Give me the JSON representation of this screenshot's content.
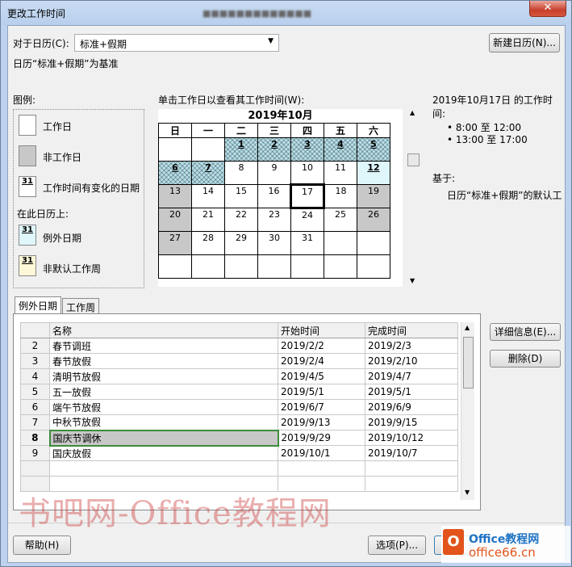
{
  "window": {
    "title": "更改工作时间",
    "subtitle": "■■■■■■■■■■■■■"
  },
  "calendar_for": {
    "label": "对于日历(C):",
    "value": "标准+假期"
  },
  "base_note": "日历“标准+假期”为基准",
  "new_calendar_button": "新建日历(N)...",
  "legend": {
    "title": "图例:",
    "items": [
      {
        "label": "工作日",
        "style": "working"
      },
      {
        "label": "非工作日",
        "style": "nonworking"
      },
      {
        "label": "工作时间有变化的日期",
        "style": "changed",
        "sample": "31"
      }
    ],
    "on_this_calendar": "在此日历上:",
    "calendar_items": [
      {
        "label": "例外日期",
        "style": "exception",
        "sample": "31"
      },
      {
        "label": "非默认工作周",
        "style": "nondefault",
        "sample": "31"
      }
    ]
  },
  "calendar": {
    "prompt": "单击工作日以查看其工作时间(W):",
    "month_title": "2019年10月",
    "weekdays": [
      "日",
      "一",
      "二",
      "三",
      "四",
      "五",
      "六"
    ],
    "weeks": [
      [
        {
          "d": "",
          "t": "blank"
        },
        {
          "d": "",
          "t": "blank"
        },
        {
          "d": "1",
          "t": "ex"
        },
        {
          "d": "2",
          "t": "ex"
        },
        {
          "d": "3",
          "t": "ex"
        },
        {
          "d": "4",
          "t": "ex"
        },
        {
          "d": "5",
          "t": "ex"
        }
      ],
      [
        {
          "d": "6",
          "t": "ex"
        },
        {
          "d": "7",
          "t": "ex"
        },
        {
          "d": "8",
          "t": "w"
        },
        {
          "d": "9",
          "t": "w"
        },
        {
          "d": "10",
          "t": "w"
        },
        {
          "d": "11",
          "t": "w"
        },
        {
          "d": "12",
          "t": "ch"
        }
      ],
      [
        {
          "d": "13",
          "t": "nw"
        },
        {
          "d": "14",
          "t": "w"
        },
        {
          "d": "15",
          "t": "w"
        },
        {
          "d": "16",
          "t": "w"
        },
        {
          "d": "17",
          "t": "today"
        },
        {
          "d": "18",
          "t": "w"
        },
        {
          "d": "19",
          "t": "nw"
        }
      ],
      [
        {
          "d": "20",
          "t": "nw"
        },
        {
          "d": "21",
          "t": "w"
        },
        {
          "d": "22",
          "t": "w"
        },
        {
          "d": "23",
          "t": "w"
        },
        {
          "d": "24",
          "t": "w"
        },
        {
          "d": "25",
          "t": "w"
        },
        {
          "d": "26",
          "t": "nw"
        }
      ],
      [
        {
          "d": "27",
          "t": "nw"
        },
        {
          "d": "28",
          "t": "w"
        },
        {
          "d": "29",
          "t": "w"
        },
        {
          "d": "30",
          "t": "w"
        },
        {
          "d": "31",
          "t": "w"
        },
        {
          "d": "",
          "t": "blank"
        },
        {
          "d": "",
          "t": "blank"
        }
      ],
      [
        {
          "d": "",
          "t": "blank"
        },
        {
          "d": "",
          "t": "blank"
        },
        {
          "d": "",
          "t": "blank"
        },
        {
          "d": "",
          "t": "blank"
        },
        {
          "d": "",
          "t": "blank"
        },
        {
          "d": "",
          "t": "blank"
        },
        {
          "d": "",
          "t": "blank"
        }
      ]
    ]
  },
  "work_times": {
    "heading": "2019年10月17日 的工作时间:",
    "items": [
      "8:00 至 12:00",
      "13:00 至 17:00"
    ],
    "based_on_label": "基于:",
    "based_on_text": "日历“标准+假期”的默认工"
  },
  "tabs": [
    "例外日期",
    "工作周"
  ],
  "exceptions_table": {
    "headers": [
      "名称",
      "开始时间",
      "完成时间"
    ],
    "rows": [
      {
        "n": "2",
        "name": "春节调班",
        "start": "2019/2/2",
        "end": "2019/2/3"
      },
      {
        "n": "3",
        "name": "春节放假",
        "start": "2019/2/4",
        "end": "2019/2/10"
      },
      {
        "n": "4",
        "name": "清明节放假",
        "start": "2019/4/5",
        "end": "2019/4/7"
      },
      {
        "n": "5",
        "name": "五一放假",
        "start": "2019/5/1",
        "end": "2019/5/1"
      },
      {
        "n": "6",
        "name": "端午节放假",
        "start": "2019/6/7",
        "end": "2019/6/9"
      },
      {
        "n": "7",
        "name": "中秋节放假",
        "start": "2019/9/13",
        "end": "2019/9/15"
      },
      {
        "n": "8",
        "name": "国庆节调休",
        "start": "2019/9/29",
        "end": "2019/10/12",
        "selected": true
      },
      {
        "n": "9",
        "name": "国庆放假",
        "start": "2019/10/1",
        "end": "2019/10/7"
      },
      {
        "n": "",
        "name": "",
        "start": "",
        "end": ""
      },
      {
        "n": "",
        "name": "",
        "start": "",
        "end": ""
      }
    ]
  },
  "details_button": "详细信息(E)...",
  "delete_button": "删除(D)",
  "help_button": "帮助(H)",
  "options_button": "选项(P)...",
  "watermark": "书吧网-Office教程网",
  "logo": {
    "line1": "Office教程网",
    "line2": "office66.cn"
  },
  "colors": {
    "exception_fill": "#b8e0e6",
    "nonworking_fill": "#c8c8c8",
    "selection_border": "#3c8c3c",
    "titlebar": "#bcd2ee"
  }
}
